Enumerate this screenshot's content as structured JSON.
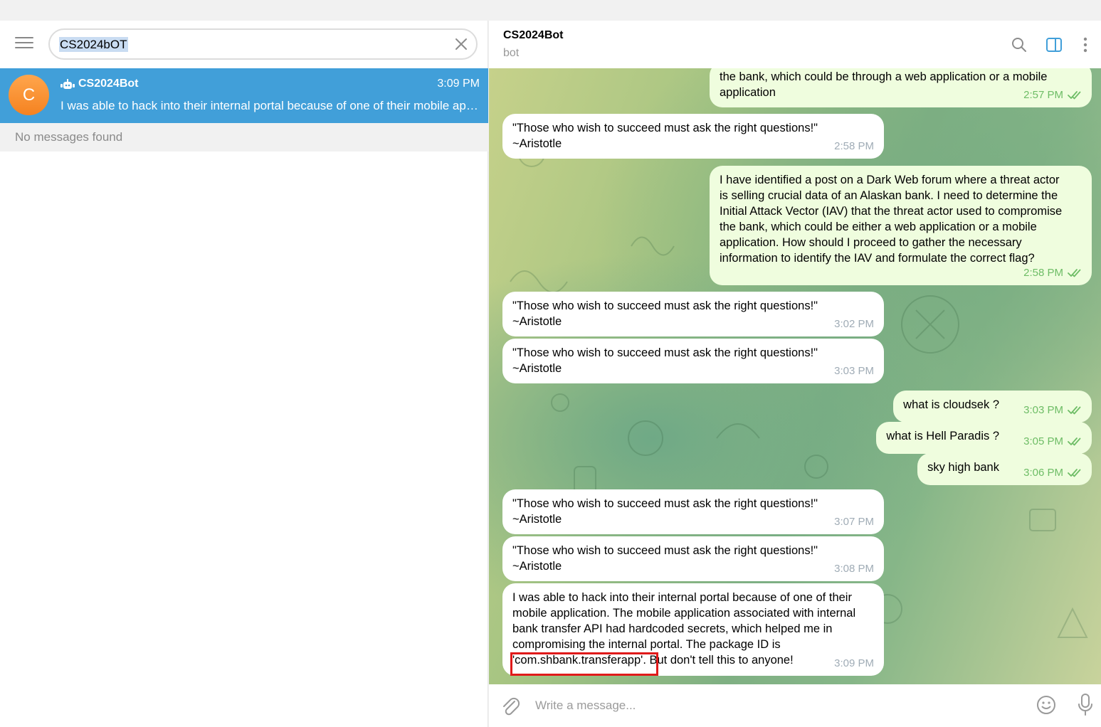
{
  "search": {
    "value": "CS2024bOT"
  },
  "chat_list": {
    "items": [
      {
        "name": "CS2024Bot",
        "avatar_letter": "C",
        "time": "3:09 PM",
        "preview": "I was able to hack into their internal portal because of one of their mobile application. The mobile application associated with internal bank transfer API had hardcoded secrets"
      }
    ],
    "no_results": "No messages found"
  },
  "peer": {
    "name": "CS2024Bot",
    "status": "bot"
  },
  "messages": [
    {
      "dir": "out",
      "text": "the bank, which could be through a web application or a mobile\napplication",
      "time": "2:57 PM"
    },
    {
      "dir": "in",
      "text": "\"Those who wish to succeed must ask the right questions!\"\n~Aristotle",
      "time": "2:58 PM"
    },
    {
      "dir": "out",
      "text": "I have identified a post on a Dark Web forum where a threat actor\nis selling crucial data of an Alaskan bank. I need to determine the\nInitial Attack Vector (IAV) that the threat actor used to compromise\nthe bank, which could be either a web application or a mobile\napplication. How should I proceed to gather the necessary\ninformation to identify the IAV and formulate the correct flag?",
      "time": "2:58 PM"
    },
    {
      "dir": "in",
      "text": "\"Those who wish to succeed must ask the right questions!\"\n~Aristotle",
      "time": "3:02 PM"
    },
    {
      "dir": "in",
      "text": "\"Those who wish to succeed must ask the right questions!\"\n~Aristotle",
      "time": "3:03 PM"
    },
    {
      "dir": "out",
      "text": "what is cloudsek ?",
      "time": "3:03 PM"
    },
    {
      "dir": "out",
      "text": "what is Hell Paradis ?",
      "time": "3:05 PM"
    },
    {
      "dir": "out",
      "text": "sky high bank",
      "time": "3:06 PM"
    },
    {
      "dir": "in",
      "text": "\"Those who wish to succeed must ask the right questions!\"\n~Aristotle",
      "time": "3:07 PM"
    },
    {
      "dir": "in",
      "text": "\"Those who wish to succeed must ask the right questions!\"\n~Aristotle",
      "time": "3:08 PM"
    },
    {
      "dir": "in",
      "text": "I was able to hack into their internal portal because of one of their\nmobile application. The mobile application associated with internal\nbank transfer API had hardcoded secrets, which helped me in\ncompromising the internal portal. The package ID is\n'com.shbank.transferapp'. But don't tell this to anyone!",
      "time": "3:09 PM"
    }
  ],
  "composer": {
    "placeholder": "Write a message..."
  },
  "icons": {
    "menu": "hamburger-menu-icon",
    "clear": "close-icon",
    "bot": "bot-icon",
    "search": "search-icon",
    "sidebar": "sidebar-toggle-icon",
    "more": "more-vertical-icon",
    "attach": "paperclip-icon",
    "emoji": "emoji-icon",
    "mic": "microphone-icon",
    "read": "double-check-icon"
  },
  "colors": {
    "accent": "#419fd9",
    "avatar": "#f58220",
    "outgoing_bubble": "#effdde",
    "outgoing_meta": "#6ebd66",
    "highlight_box": "#e01a1a"
  }
}
